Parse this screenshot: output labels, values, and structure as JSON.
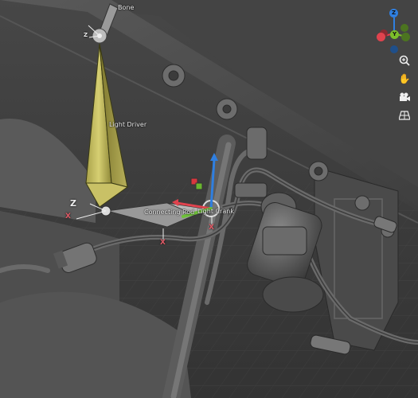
{
  "viewport": {
    "bone_labels": {
      "bone": "Bone",
      "light_driver": "Light Driver",
      "connecting_rod": "Connecting Rod",
      "light_crank": "Light Crank"
    },
    "axis_labels": {
      "z_upper": "Z",
      "z_lower": "Z",
      "x_left": "X",
      "x_crank": "X",
      "x_rod": "X"
    }
  },
  "gizmo": {
    "z_label": "Z",
    "y_label": "Y",
    "colors": {
      "x": "#e0434e",
      "y": "#7bbf2a",
      "z": "#2f7fe0"
    }
  },
  "nav_tools": [
    {
      "name": "zoom",
      "icon": "zoom-icon"
    },
    {
      "name": "pan",
      "icon": "hand-icon"
    },
    {
      "name": "camera",
      "icon": "camera-icon"
    },
    {
      "name": "perspective",
      "icon": "grid-icon"
    }
  ]
}
